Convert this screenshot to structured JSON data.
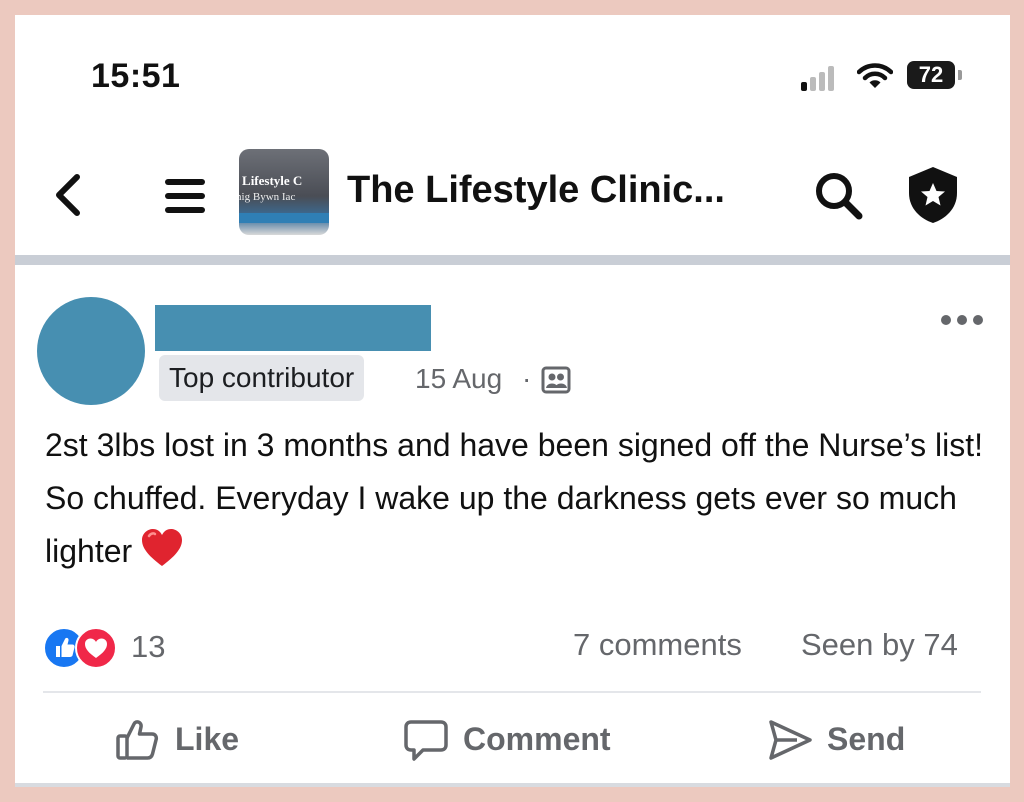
{
  "status_bar": {
    "time": "15:51",
    "battery_level": "72",
    "signal_bars_active": 1,
    "icons": [
      "signal-icon",
      "wifi-icon",
      "battery-icon"
    ]
  },
  "header": {
    "group_title": "The Lifestyle Clinic...",
    "thumbnail_text_line1": "e Lifestyle C",
    "thumbnail_text_line2": "inig Bywn Iac",
    "icons": [
      "back-icon",
      "menu-icon",
      "search-icon",
      "shield-star-icon"
    ]
  },
  "post": {
    "badge": "Top contributor",
    "date": "15 Aug",
    "separator": "·",
    "text": "2st 3lbs lost in 3 months and have been signed off the Nurse’s list! So chuffed. Everyday I wake up the darkness gets ever so much lighter",
    "reaction_count": "13",
    "comments": "7 comments",
    "seen_by": "Seen by 74"
  },
  "actions": {
    "like": "Like",
    "comment": "Comment",
    "send": "Send"
  },
  "colors": {
    "redaction": "#478fb1",
    "like_blue": "#1877f2",
    "love_red": "#f02849",
    "secondary_text": "#65676b",
    "page_border": "#ecc9bf"
  }
}
